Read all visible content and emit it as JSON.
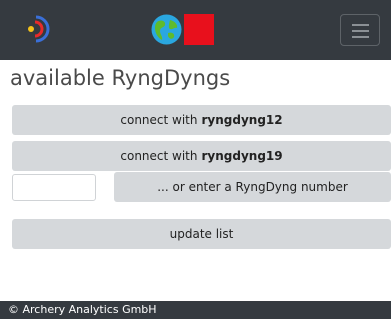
{
  "navbar": {
    "logo_icon": "archery-target-icon",
    "globe_icon": "globe-icon",
    "flag_icon": "red-square-icon",
    "flag_color": "#e8101c",
    "menu_icon": "hamburger-menu-icon",
    "background_color": "#353a40"
  },
  "page": {
    "title": "available RyngDyngs"
  },
  "devices": [
    {
      "prefix": "connect with",
      "name": "ryngdyng12"
    },
    {
      "prefix": "connect with",
      "name": "ryngdyng19"
    }
  ],
  "manual_entry": {
    "input_value": "",
    "button_label": "... or enter a RyngDyng number"
  },
  "actions": {
    "update_label": "update list"
  },
  "footer": {
    "text": "© Archery Analytics GmbH"
  },
  "colors": {
    "button_bg": "#d5d8db",
    "page_bg": "#ffffff"
  }
}
